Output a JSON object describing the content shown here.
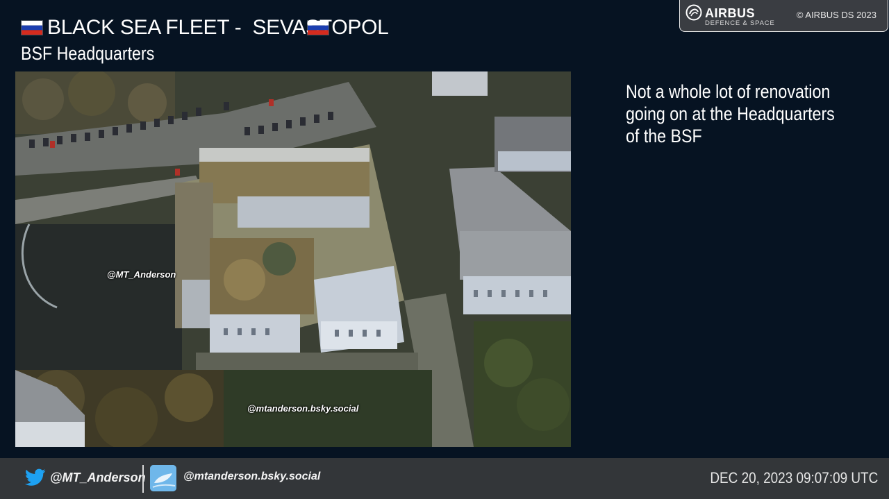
{
  "header": {
    "title": "BLACK SEA FLEET -  SEVASTOPOL",
    "subtitle": "BSF Headquarters",
    "flag_colors": [
      "#ffffff",
      "#1c3fb0",
      "#d52b1e"
    ]
  },
  "airbus_badge": {
    "brand": "AIRBUS",
    "division": "DEFENCE & SPACE",
    "copyright": "© AIRBUS DS 2023"
  },
  "image": {
    "watermark_twitter": "@MT_Anderson",
    "watermark_bsky": "@mtanderson.bsky.social"
  },
  "note": {
    "text": "Not a whole lot of renovation going on at the Headquarters of the BSF"
  },
  "footer": {
    "twitter_handle": "@MT_Anderson",
    "bsky_handle": "@mtanderson.bsky.social",
    "timestamp": "DEC 20, 2023 09:07:09 UTC",
    "twitter_color": "#1da1f2",
    "bsky_color": "#4aa3e0"
  }
}
